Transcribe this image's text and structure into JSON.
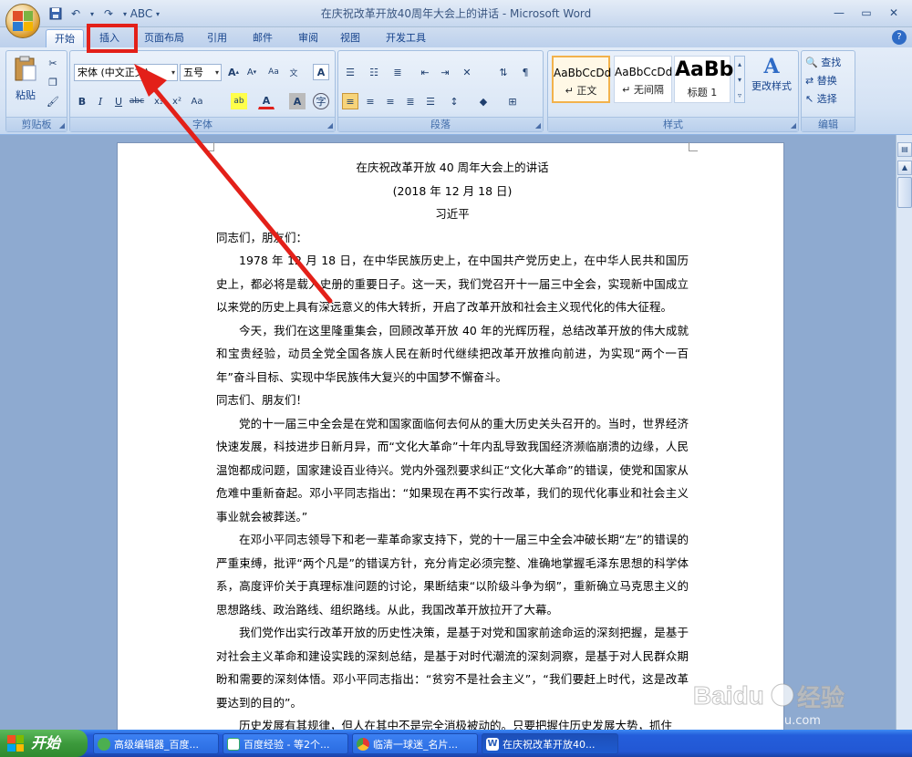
{
  "window": {
    "title": "在庆祝改革开放40周年大会上的讲话 - Microsoft Word",
    "controls": [
      "—",
      "▭",
      "✕"
    ]
  },
  "tabs": [
    "开始",
    "插入",
    "页面布局",
    "引用",
    "邮件",
    "审阅",
    "视图",
    "开发工具"
  ],
  "ribbon": {
    "clipboard": {
      "paste_label": "粘贴",
      "group_label": "剪贴板"
    },
    "font": {
      "font_name": "宋体 (中文正文)",
      "font_size": "五号",
      "group_label": "字体"
    },
    "paragraph": {
      "group_label": "段落"
    },
    "styles": {
      "items": [
        {
          "preview": "AaBbCcDd",
          "name": "↵ 正文"
        },
        {
          "preview": "AaBbCcDd",
          "name": "↵ 无间隔"
        },
        {
          "preview": "AaBb",
          "name": "标题 1"
        }
      ],
      "change_styles": "更改样式",
      "group_label": "样式"
    },
    "editing": {
      "find": "查找",
      "replace": "替换",
      "select": "选择",
      "group_label": "编辑"
    }
  },
  "document": {
    "title": "在庆祝改革开放 40 周年大会上的讲话",
    "date": "(2018 年 12 月 18 日)",
    "author": "习近平",
    "salutation1": "同志们，朋友们：",
    "p1": "1978 年 12 月 18 日，在中华民族历史上，在中国共产党历史上，在中华人民共和国历史上，都必将是载入史册的重要日子。这一天，我们党召开十一届三中全会，实现新中国成立以来党的历史上具有深远意义的伟大转折，开启了改革开放和社会主义现代化的伟大征程。",
    "p2": "今天，我们在这里隆重集会，回顾改革开放 40 年的光辉历程，总结改革开放的伟大成就和宝贵经验，动员全党全国各族人民在新时代继续把改革开放推向前进，为实现“两个一百年”奋斗目标、实现中华民族伟大复兴的中国梦不懈奋斗。",
    "salutation2": "同志们、朋友们！",
    "p3": "党的十一届三中全会是在党和国家面临何去何从的重大历史关头召开的。当时，世界经济快速发展，科技进步日新月异，而“文化大革命”十年内乱导致我国经济濒临崩溃的边缘，人民温饱都成问题，国家建设百业待兴。党内外强烈要求纠正“文化大革命”的错误，使党和国家从危难中重新奋起。邓小平同志指出：“如果现在再不实行改革，我们的现代化事业和社会主义事业就会被葬送。”",
    "p4": "在邓小平同志领导下和老一辈革命家支持下，党的十一届三中全会冲破长期“左”的错误的严重束缚，批评“两个凡是”的错误方针，充分肯定必须完整、准确地掌握毛泽东思想的科学体系，高度评价关于真理标准问题的讨论，果断结束“以阶级斗争为纲”，重新确立马克思主义的思想路线、政治路线、组织路线。从此，我国改革开放拉开了大幕。",
    "p5": "我们党作出实行改革开放的历史性决策，是基于对党和国家前途命运的深刻把握，是基于对社会主义革命和建设实践的深刻总结，是基于对时代潮流的深刻洞察，是基于对人民群众期盼和需要的深刻体悟。邓小平同志指出：“贫穷不是社会主义”，“我们要赶上时代，这是改革要达到的目的”。",
    "p6": "历史发展有其规律，但人在其中不是完全消极被动的。只要把握住历史发展大势，抓住"
  },
  "taskbar": {
    "start": "开始",
    "tasks": [
      "高级编辑器_百度...",
      "百度经验 - 等2个...",
      "临清一球迷_名片...",
      "在庆祝改革开放40..."
    ]
  },
  "watermark": {
    "brand": "Baidu",
    "product": "经验",
    "url": "jingyan.baidu.com"
  }
}
